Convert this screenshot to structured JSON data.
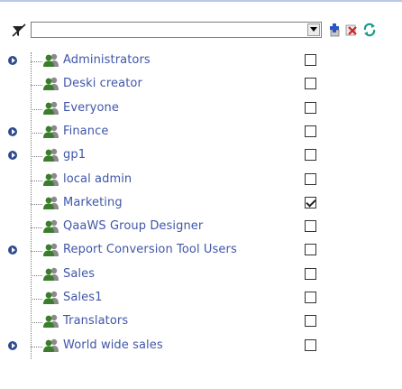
{
  "toolbar": {
    "filter_value": "",
    "icons": {
      "filter": "funnel-clear-icon",
      "dropdown": "chevron-down-icon",
      "add": "add-group-icon",
      "remove": "remove-group-icon",
      "refresh": "refresh-icon"
    }
  },
  "colors": {
    "group_label": "#3f56a9",
    "expand_toggle": "#2f4b8f",
    "top_rule": "#b8c8e6"
  },
  "groups": [
    {
      "name": "Administrators",
      "expandable": true,
      "checked": false
    },
    {
      "name": "Deski creator",
      "expandable": false,
      "checked": false
    },
    {
      "name": "Everyone",
      "expandable": false,
      "checked": false
    },
    {
      "name": "Finance",
      "expandable": true,
      "checked": false
    },
    {
      "name": "gp1",
      "expandable": true,
      "checked": false
    },
    {
      "name": "local admin",
      "expandable": false,
      "checked": false
    },
    {
      "name": "Marketing",
      "expandable": false,
      "checked": true
    },
    {
      "name": "QaaWS Group Designer",
      "expandable": false,
      "checked": false
    },
    {
      "name": "Report Conversion Tool Users",
      "expandable": true,
      "checked": false
    },
    {
      "name": "Sales",
      "expandable": false,
      "checked": false
    },
    {
      "name": "Sales1",
      "expandable": false,
      "checked": false
    },
    {
      "name": "Translators",
      "expandable": false,
      "checked": false
    },
    {
      "name": "World wide sales",
      "expandable": true,
      "checked": false
    }
  ]
}
